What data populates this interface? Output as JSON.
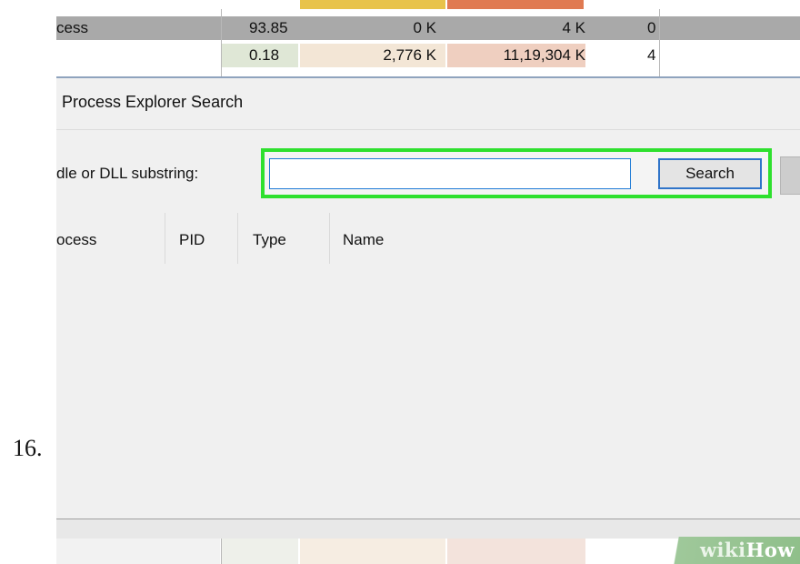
{
  "step_number": "16.",
  "process_table": {
    "rows": [
      {
        "name": "cess",
        "cpu": "93.85",
        "private": "0 K",
        "working": "4 K",
        "last": "0"
      },
      {
        "name": "",
        "cpu": "0.18",
        "private": "2,776 K",
        "working": "11,19,304 K",
        "last": "4"
      }
    ],
    "colors": {
      "selected_row": "#a9a9a9",
      "cpu_tint": "#dfe7d6",
      "private_tint": "#f3e6d6",
      "working_tint": "#efcfc0",
      "band_yellow": "#e8c34a",
      "band_orange": "#e07a52"
    }
  },
  "dialog": {
    "title": "Process Explorer Search",
    "search_label": "dle or DLL substring:",
    "input_value": "",
    "search_button": "Search",
    "highlight_color": "#2ee02e"
  },
  "results": {
    "columns": [
      "ocess",
      "PID",
      "Type",
      "Name"
    ]
  },
  "watermark": {
    "part1": "wiki",
    "part2": "How"
  }
}
